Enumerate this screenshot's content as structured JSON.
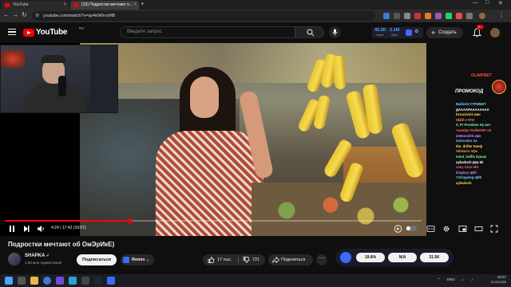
{
  "browser": {
    "tabs": [
      {
        "label": "YouTube"
      },
      {
        "label": "(10) Подростки мечтают о..."
      }
    ],
    "url": "youtube.com/watch?v=sp4eWIrvxM8"
  },
  "header": {
    "logo_text": "YouTube",
    "region": "RU",
    "search_placeholder": "Введите запрос",
    "stats": {
      "val1": "49.2K",
      "lbl1": "Views",
      "val2": "2.1M",
      "lbl2": "Subs"
    },
    "create_label": "Создать",
    "notif_count": "9+"
  },
  "player": {
    "progress_fraction": 0.3,
    "timecode": "4:24 / 17:42 (16:57)"
  },
  "chat": {
    "olimp": "OLIMPBET",
    "promo": "ПРОМОКОД",
    "lines": [
      {
        "text": "Ballin33 СТРИМИТ",
        "color": "#7ad0ff"
      },
      {
        "text": "ДААААРАААААААА",
        "color": "#ffffff"
      },
      {
        "text": "b1ou1ivin1 вин",
        "color": "#ffdd55"
      },
      {
        "text": "Skilll 1 ЧТО",
        "color": "#ff9a4a"
      },
      {
        "text": "d_Pr Promitos Ну вот",
        "color": "#7affa2"
      },
      {
        "text": "Youtube ПАЙНТЕР ХЗ",
        "color": "#ff6a6a"
      },
      {
        "text": "deMonolith кфк",
        "color": "#c08aff"
      },
      {
        "text": "mirocoloo ла",
        "color": "#7ad0ff"
      },
      {
        "text": "the_drifter Кинф",
        "color": "#ffdd55"
      },
      {
        "text": "Allstarrrr кфк",
        "color": "#ff9a4a"
      },
      {
        "text": "mind_traffic Кушак",
        "color": "#7affa2"
      },
      {
        "text": "aybaduch Дер 6k",
        "color": "#ffffff"
      },
      {
        "text": "Joey rizzo 5k3",
        "color": "#ff6a6a"
      },
      {
        "text": "kingboy ЦЁЁ",
        "color": "#c08aff"
      },
      {
        "text": "Y1l1ngsmg ЦЁЁ",
        "color": "#7ad0ff"
      },
      {
        "text": "aybaduch",
        "color": "#ffdd55"
      }
    ]
  },
  "video_info": {
    "title": "Подростки мечтают об ОмЭрИкЕ)",
    "channel": "SHAPKA",
    "subs": "1,59 млн подписчиков",
    "subscribe": "Подписаться",
    "remix": "Remix",
    "likes": "17 тыс.",
    "dislikes": "721",
    "share": "Поделиться",
    "ext_values": [
      "19.8%",
      "N/A",
      "31.5K"
    ]
  },
  "taskbar": {
    "lang": "ENG",
    "time": "18:37",
    "date": "01.03.2025"
  },
  "colors": {
    "accent": "#ff0000",
    "bg": "#0f0f0f"
  }
}
